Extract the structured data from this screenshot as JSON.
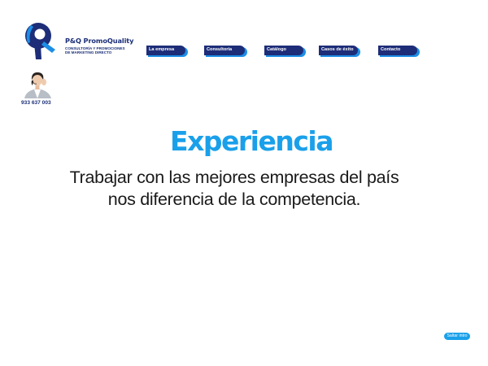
{
  "brand": {
    "name": "P&Q PromoQuality",
    "tagline_line1": "CONSULTORÍA Y PROMOCIONES",
    "tagline_line2": "DE MARKETING DIRECTO",
    "logo_icon": "pq-logo-icon",
    "colors": {
      "navy": "#1d2d78",
      "accent_blue": "#1aa0ea"
    }
  },
  "nav": {
    "items": [
      {
        "label": "La empresa"
      },
      {
        "label": "Consultoría"
      },
      {
        "label": "Catálogo"
      },
      {
        "label": "Casos de éxito"
      },
      {
        "label": "Contacto"
      }
    ]
  },
  "contact": {
    "avatar_icon": "operator-avatar-icon",
    "phone": "933 637 003"
  },
  "main": {
    "headline": "Experiencia",
    "subtext_line1": "Trabajar con las mejores empresas del país",
    "subtext_line2": "nos diferencia de la competencia."
  },
  "skip_intro": {
    "label": "Saltar intro"
  }
}
